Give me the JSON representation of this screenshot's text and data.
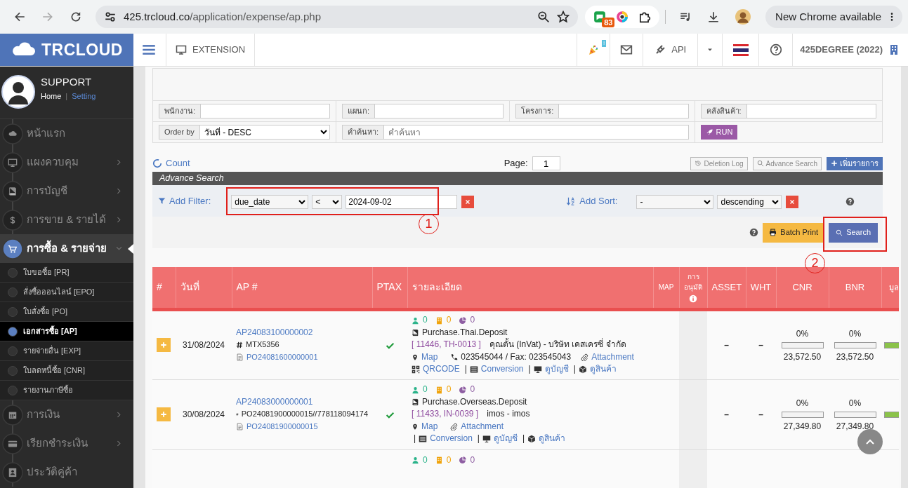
{
  "browser": {
    "url_host": "425.trcloud.co",
    "url_path": "/application/expense/ap.php",
    "extension_badge": "83",
    "update_button": "New Chrome available"
  },
  "navbar": {
    "logo": "TRCLOUD",
    "extension": "EXTENSION",
    "notification_badge": "!",
    "api": "API",
    "company": "425DEGREE (2022)"
  },
  "sidebar": {
    "user": "SUPPORT",
    "home_link": "Home",
    "separator": "|",
    "setting_link": "Setting",
    "items": [
      {
        "label": "หน้าแรก",
        "expandable": false,
        "selected": false
      },
      {
        "label": "แผงควบคุม",
        "expandable": true,
        "expanded": false,
        "selected": false
      },
      {
        "label": "การบัญชี",
        "expandable": true,
        "expanded": false,
        "selected": false
      },
      {
        "label": "การขาย & รายได้",
        "expandable": true,
        "expanded": false,
        "selected": false
      },
      {
        "label": "การซื้อ & รายจ่าย",
        "expandable": true,
        "expanded": true,
        "selected": true,
        "children": [
          {
            "label": "ใบขอซื้อ [PR]",
            "selected": false
          },
          {
            "label": "สั่งซื้อออนไลน์ [EPO]",
            "selected": false
          },
          {
            "label": "ใบสั่งซื้อ [PO]",
            "selected": false
          },
          {
            "label": "เอกสารซื้อ [AP]",
            "selected": true
          },
          {
            "label": "รายจ่ายอื่น [EXP]",
            "selected": false
          },
          {
            "label": "ใบลดหนี้ซื้อ [CNR]",
            "selected": false
          },
          {
            "label": "รายงานภาษีซื้อ",
            "selected": false
          }
        ]
      },
      {
        "label": "การเงิน",
        "expandable": true,
        "expanded": false,
        "selected": false
      },
      {
        "label": "เรียกชำระเงิน",
        "expandable": true,
        "expanded": false,
        "selected": false
      },
      {
        "label": "ประวัติคู่ค้า",
        "expandable": false,
        "selected": false
      }
    ]
  },
  "filters": {
    "fields": [
      {
        "label": "พนักงาน:"
      },
      {
        "label": "แผนก:"
      },
      {
        "label": "โครงการ:"
      },
      {
        "label": "คลังสินค้า:"
      }
    ],
    "order_by": {
      "label": "Order by",
      "value": "วันที่ - DESC"
    },
    "search": {
      "label": "คำค้นหา:",
      "placeholder": "คำค้นหา"
    },
    "run_button": "RUN"
  },
  "toolbar": {
    "count_link": "Count",
    "page_label": "Page:",
    "page_value": "1",
    "buttons": [
      {
        "kind": "history",
        "label": "Deletion Log"
      },
      {
        "kind": "search",
        "label": "Advance Search"
      },
      {
        "kind": "add",
        "label": "เพิ่มรายการ"
      }
    ]
  },
  "advance_search": {
    "title": "Advance Search",
    "filter_label": "Add Filter:",
    "filter_field": "due_date",
    "operator": "<",
    "filter_value": "2024-09-02",
    "sort_label": "Add Sort:",
    "sort_field": "-",
    "sort_order": "descending",
    "batch_print": "Batch Print",
    "search_button": "Search"
  },
  "annotations": [
    {
      "kind": "filter",
      "label": "1"
    },
    {
      "kind": "search",
      "label": "2"
    }
  ],
  "table": {
    "columns": [
      "#",
      "วันที่",
      "AP #",
      "PTAX",
      "รายละเอียด",
      "MAP",
      "การอนุมัติ",
      "ASSET",
      "WHT",
      "CNR",
      "BNR",
      "มูล"
    ],
    "rows": [
      {
        "date": "31/08/2024",
        "ap_no": "AP24083100000002",
        "reference": "MTX5356",
        "po_link": "PO24081600000001",
        "ptax": true,
        "counts": [
          "0",
          "0",
          "0"
        ],
        "account": "Purchase.Thai.Deposit",
        "contact_code": "[ 11446, TH-0013 ]",
        "contact_name": "คุณตั้น (InVat) - บริษัท เคสเครซี่ จำกัด",
        "map": "Map",
        "phone": "023545044 / Fax: 023545043",
        "attachment": "Attachment",
        "links": [
          {
            "kind": "qrcode",
            "label": "QRCODE"
          },
          {
            "kind": "conversion",
            "label": "Conversion",
            "separator": "|"
          },
          {
            "kind": "ledger",
            "label": "ดูบัญชี",
            "separator": "|"
          },
          {
            "kind": "product",
            "label": "ดูสินค้า",
            "separator": "|"
          }
        ],
        "asset": "–",
        "wht": "–",
        "cnr": {
          "percent": "0%",
          "level": 0,
          "amount": "23,572.50"
        },
        "bnr": {
          "percent": "0%",
          "level": 0,
          "amount": "23,572.50"
        },
        "column_12": {
          "level": 1
        }
      },
      {
        "date": "30/08/2024",
        "ap_no": "AP24083000000001",
        "reference": "PO24081900000015//778118094174",
        "po_link": "PO24081900000015",
        "ptax": true,
        "counts": [
          "0",
          "0",
          "0"
        ],
        "account": "Purchase.Overseas.Deposit",
        "contact_code": "[ 11433, IN-0039 ]",
        "contact_name": "imos - imos",
        "map": "Map",
        "attachment": "Attachment",
        "links": [
          {
            "kind": "conversion",
            "label": "Conversion",
            "separator": "|"
          },
          {
            "kind": "ledger",
            "label": "ดูบัญชี",
            "separator": "|"
          },
          {
            "kind": "product",
            "label": "ดูสินค้า",
            "separator": "|"
          }
        ],
        "asset": "–",
        "wht": "–",
        "cnr": {
          "percent": "0%",
          "level": 0,
          "amount": "27,349.80"
        },
        "bnr": {
          "percent": "0%",
          "level": 0,
          "amount": "27,349.80"
        },
        "column_12": {
          "level": 1
        }
      },
      {
        "counts": [
          "0",
          "0",
          "0"
        ]
      }
    ]
  }
}
